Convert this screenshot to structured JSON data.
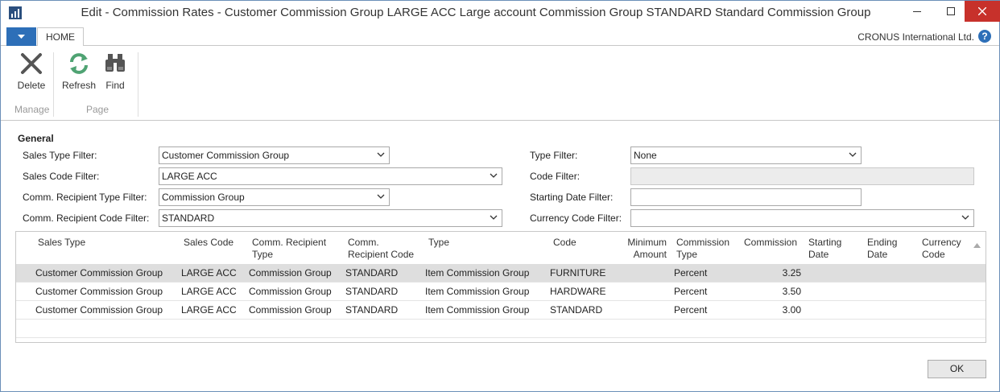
{
  "window": {
    "title": "Edit - Commission Rates - Customer Commission Group LARGE ACC Large account Commission Group STANDARD Standard Commission Group",
    "app_icon": "nav-app-icon",
    "close_color": "#c7312b"
  },
  "ribbon": {
    "tab_home": "HOME",
    "company": "CRONUS International Ltd.",
    "help": "?",
    "buttons": {
      "delete": "Delete",
      "refresh": "Refresh",
      "find": "Find"
    },
    "groups": {
      "manage": "Manage",
      "page": "Page"
    }
  },
  "general": {
    "title": "General",
    "sales_type_filter": {
      "label": "Sales Type Filter:",
      "value": "Customer Commission Group"
    },
    "sales_code_filter": {
      "label": "Sales Code Filter:",
      "value": "LARGE ACC"
    },
    "comm_recipient_type_filter": {
      "label": "Comm. Recipient Type Filter:",
      "value": "Commission Group"
    },
    "comm_recipient_code_filter": {
      "label": "Comm. Recipient Code Filter:",
      "value": "STANDARD"
    },
    "type_filter": {
      "label": "Type Filter:",
      "value": "None"
    },
    "code_filter": {
      "label": "Code Filter:",
      "value": ""
    },
    "starting_date_filter": {
      "label": "Starting Date Filter:",
      "value": ""
    },
    "currency_code_filter": {
      "label": "Currency Code Filter:",
      "value": ""
    }
  },
  "grid": {
    "headers": {
      "sales_type": "Sales Type",
      "sales_code": "Sales Code",
      "comm_recipient_type_1": "Comm. Recipient",
      "comm_recipient_type_2": "Type",
      "comm_recipient_code_1": "Comm.",
      "comm_recipient_code_2": "Recipient Code",
      "type": "Type",
      "code": "Code",
      "minimum_amount_1": "Minimum",
      "minimum_amount_2": "Amount",
      "commission_type_1": "Commission",
      "commission_type_2": "Type",
      "commission": "Commission",
      "starting_date_1": "Starting",
      "starting_date_2": "Date",
      "ending_date_1": "Ending",
      "ending_date_2": "Date",
      "currency_code_1": "Currency",
      "currency_code_2": "Code"
    },
    "rows": [
      {
        "sales_type": "Customer Commission Group",
        "sales_code": "LARGE ACC",
        "comm_recipient_type": "Commission Group",
        "comm_recipient_code": "STANDARD",
        "type": "Item Commission Group",
        "code": "FURNITURE",
        "minimum_amount": "",
        "commission_type": "Percent",
        "commission": "3.25",
        "starting_date": "",
        "ending_date": "",
        "currency_code": ""
      },
      {
        "sales_type": "Customer Commission Group",
        "sales_code": "LARGE ACC",
        "comm_recipient_type": "Commission Group",
        "comm_recipient_code": "STANDARD",
        "type": "Item Commission Group",
        "code": "HARDWARE",
        "minimum_amount": "",
        "commission_type": "Percent",
        "commission": "3.50",
        "starting_date": "",
        "ending_date": "",
        "currency_code": ""
      },
      {
        "sales_type": "Customer Commission Group",
        "sales_code": "LARGE ACC",
        "comm_recipient_type": "Commission Group",
        "comm_recipient_code": "STANDARD",
        "type": "Item Commission Group",
        "code": "STANDARD",
        "minimum_amount": "",
        "commission_type": "Percent",
        "commission": "3.00",
        "starting_date": "",
        "ending_date": "",
        "currency_code": ""
      }
    ]
  },
  "footer": {
    "ok": "OK"
  }
}
